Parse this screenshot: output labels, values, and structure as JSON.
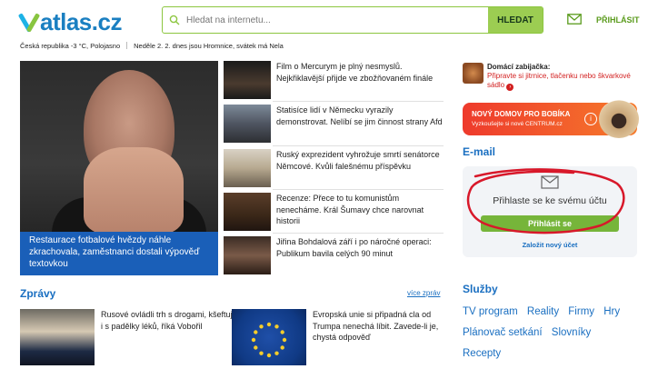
{
  "header": {
    "logo_text": "atlas.cz",
    "search_placeholder": "Hledat na internetu...",
    "search_button": "HLEDAT",
    "login_label": "PŘIHLÁSIT"
  },
  "infobar": {
    "weather": "Česká republika -3 °C, Polojasno",
    "nameday": "Neděle 2. 2. dnes jsou Hromnice, svátek má Nela"
  },
  "feature": {
    "caption": "Restaurace fotbalové hvězdy náhle zkrachovala, zaměstnanci dostali výpověď textovkou"
  },
  "mid_news": [
    {
      "text": "Film o Mercurym je plný nesmyslů. Nejkřiklavější přijde ve zbožňovaném finále"
    },
    {
      "text": "Statisíce lidí v Německu vyrazily demonstrovat. Nelíbí se jim činnost strany Afd"
    },
    {
      "text": "Ruský exprezident vyhrožuje smrtí senátorce Němcové. Kvůli falešnému příspěvku"
    },
    {
      "text": "Recenze: Přece to tu komunistům nenecháme. Král Šumavy chce narovnat historii"
    },
    {
      "text": "Jiřina Bohdalová září i po náročné operaci: Publikum bavila celých 90 minut"
    }
  ],
  "ads": {
    "zabijacka_title": "Domácí zabijačka:",
    "zabijacka_text": "Připravte si jitrnice, tlačenku nebo škvarkové sádlo",
    "bobik_title": "NOVÝ DOMOV PRO BOBÍKA",
    "bobik_text": "Vyzkoušejte si nové CENTRUM.cz",
    "info_glyph": "i",
    "arrow_glyph": "›"
  },
  "email": {
    "title": "E-mail",
    "prompt": "Přihlaste se ke svému účtu",
    "login_button": "Přihlásit se",
    "new_account": "Založit nový účet"
  },
  "zpravy": {
    "title": "Zprávy",
    "more": "více zpráv",
    "items": [
      {
        "text": "Rusové ovládli trh s drogami, kšeftují i s padělky léků, říká Vobořil"
      },
      {
        "text": "Evropská unie si připadná cla od Trumpa nenechá líbit. Zavede-li je, chystá odpověď"
      }
    ]
  },
  "sluzby": {
    "title": "Služby",
    "links": [
      "TV program",
      "Reality",
      "Firmy",
      "Hry",
      "Plánovač setkání",
      "Slovníky",
      "Recepty"
    ]
  }
}
